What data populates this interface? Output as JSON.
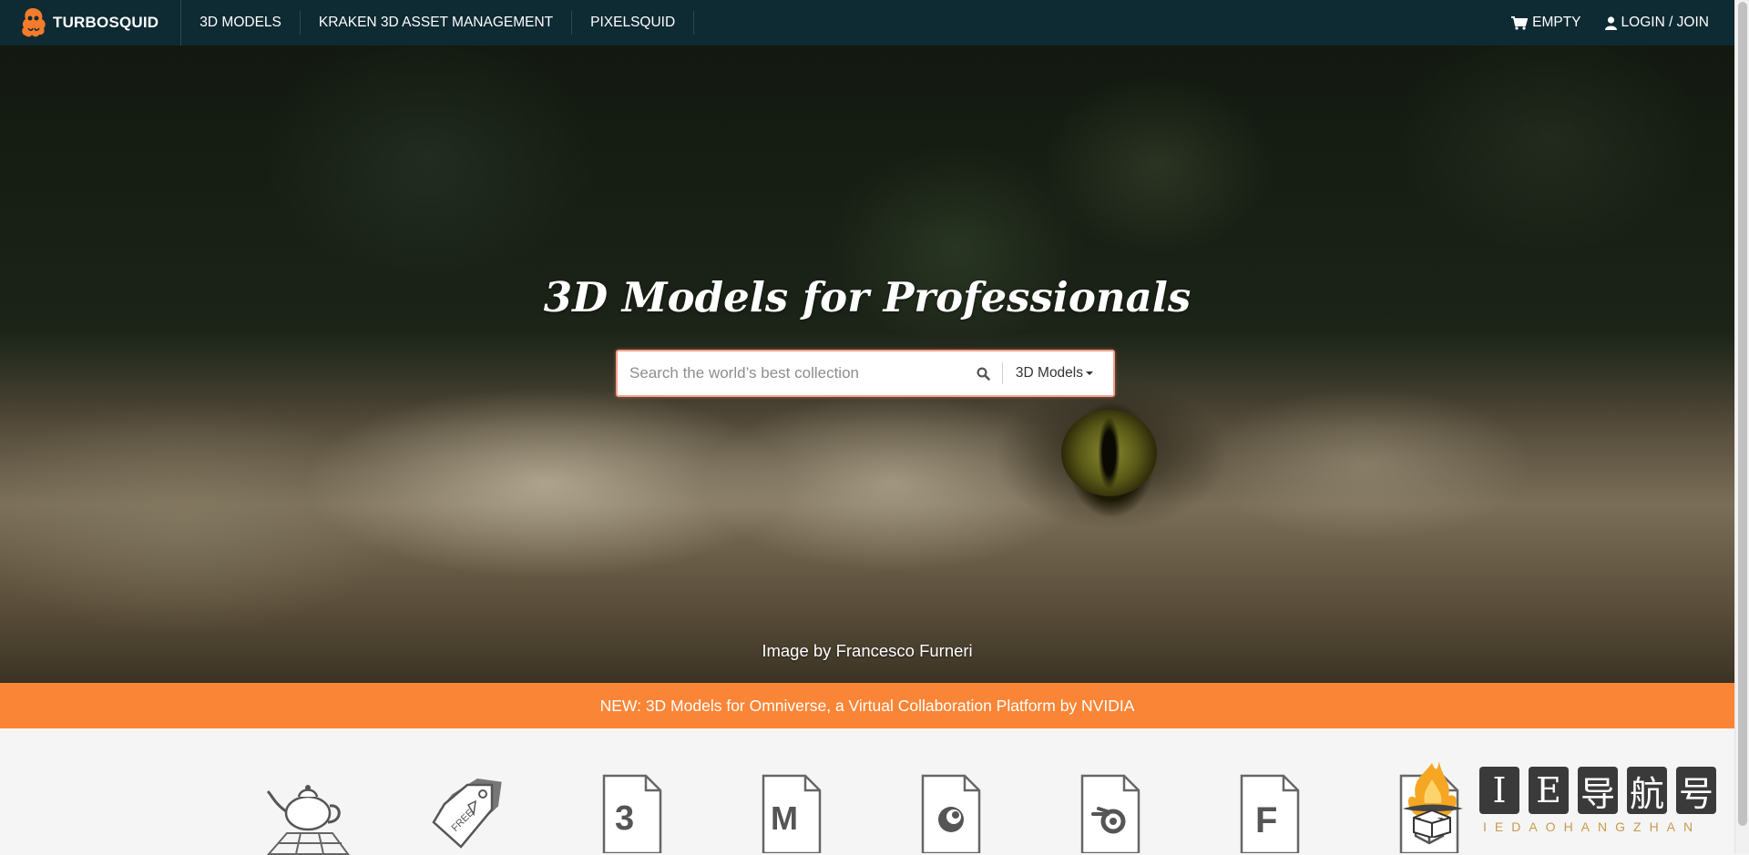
{
  "nav": {
    "brand": "TURBOSQUID",
    "links": [
      "3D MODELS",
      "KRAKEN 3D ASSET MANAGEMENT",
      "PIXELSQUID"
    ],
    "cart_label": "EMPTY",
    "login_label": "LOGIN / JOIN"
  },
  "hero": {
    "title": "3D Models for Professionals",
    "search_placeholder": "Search the world’s best collection",
    "search_type": "3D Models",
    "credit": "Image by Francesco Furneri"
  },
  "banner": {
    "text": "NEW: 3D Models for Omniverse, a Virtual Collaboration Platform by NVIDIA"
  },
  "formats": {
    "items": [
      {
        "icon": "teapot-icon"
      },
      {
        "icon": "free-tag-icon",
        "label": "FREE"
      },
      {
        "icon": "3ds-max-file-icon",
        "label": "3"
      },
      {
        "icon": "maya-file-icon",
        "label": "M"
      },
      {
        "icon": "cinema4d-file-icon"
      },
      {
        "icon": "blender-file-icon"
      },
      {
        "icon": "fbx-file-icon",
        "label": "F"
      },
      {
        "icon": "obj-file-icon"
      }
    ]
  },
  "watermark": {
    "chars": [
      "I",
      "E",
      "导",
      "航",
      "号"
    ],
    "sub": "IEDAOHANGZHAN"
  },
  "colors": {
    "nav_bg": "#0e2a33",
    "banner_bg": "#fb8536",
    "search_border": "#f3a18c"
  }
}
